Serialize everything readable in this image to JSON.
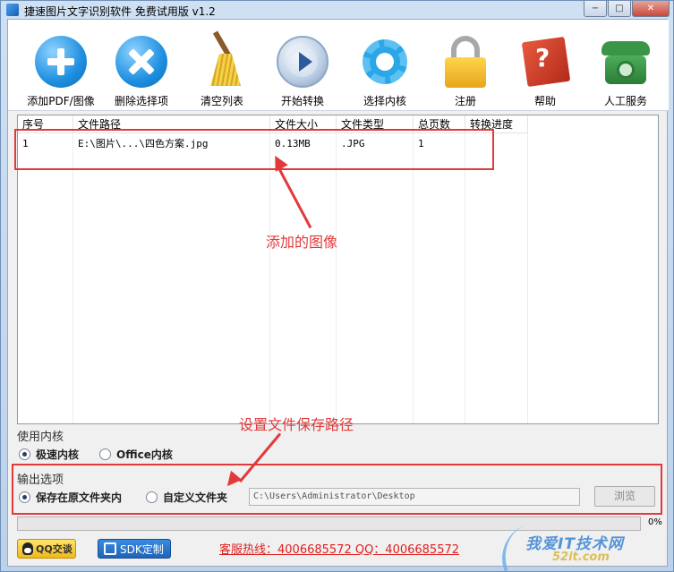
{
  "window": {
    "title": "捷速图片文字识别软件 免费试用版 v1.2",
    "minimize": "−",
    "maximize": "□",
    "close": "✕"
  },
  "toolbar": {
    "items": [
      {
        "label": "添加PDF/图像",
        "icon": "add-icon"
      },
      {
        "label": "删除选择项",
        "icon": "delete-icon"
      },
      {
        "label": "清空列表",
        "icon": "broom-icon"
      },
      {
        "label": "开始转换",
        "icon": "play-icon"
      },
      {
        "label": "选择内核",
        "icon": "gear-icon"
      },
      {
        "label": "注册",
        "icon": "lock-icon"
      },
      {
        "label": "帮助",
        "icon": "help-book-icon"
      },
      {
        "label": "人工服务",
        "icon": "phone-icon"
      }
    ]
  },
  "filelist": {
    "headers": [
      "序号",
      "文件路径",
      "文件大小",
      "文件类型",
      "总页数",
      "转换进度"
    ],
    "rows": [
      [
        "1",
        "E:\\图片\\...\\四色方案.jpg",
        "0.13MB",
        ".JPG",
        "1",
        ""
      ]
    ]
  },
  "annotations": {
    "added_image": "添加的图像",
    "set_path": "设置文件保存路径"
  },
  "engine": {
    "title": "使用内核",
    "options": [
      "极速内核",
      "Office内核"
    ],
    "selected": 0
  },
  "output": {
    "title": "输出选项",
    "options": [
      "保存在原文件夹内",
      "自定义文件夹"
    ],
    "selected": 0,
    "path_value": "C:\\Users\\Administrator\\Desktop",
    "browse_label": "浏览"
  },
  "progress": {
    "value": 0,
    "text": "0%"
  },
  "footer": {
    "qq_label": "QQ交谈",
    "sdk_label": "SDK定制",
    "hotline": "客服热线：4006685572 QQ：4006685572"
  },
  "watermark": {
    "text": "我爱IT技术网",
    "sub": "52it.com"
  },
  "colors": {
    "annotation_red": "#e23a3a",
    "hotline_red": "#e02020",
    "titlebar": "#cfe0f3"
  }
}
